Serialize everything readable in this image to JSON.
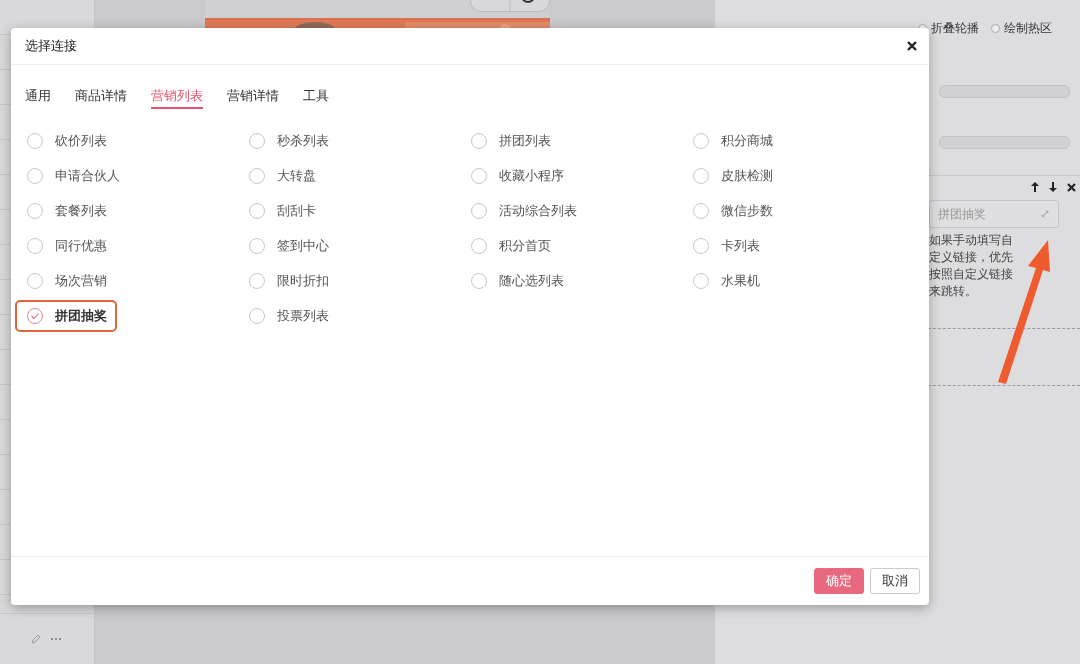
{
  "background": {
    "settings": {
      "display_options": [
        {
          "label": "折叠轮播",
          "selected": false
        },
        {
          "label": "绘制热区",
          "selected": false
        }
      ],
      "link_field": {
        "value": "拼团抽奖"
      },
      "hint": "如果手动填写自定义链接，优先按照自定义链接来跳转。"
    }
  },
  "dialog": {
    "title": "选择连接",
    "tabs": [
      {
        "label": "通用",
        "selected": false
      },
      {
        "label": "商品详情",
        "selected": false
      },
      {
        "label": "营销列表",
        "selected": true
      },
      {
        "label": "营销详情",
        "selected": false
      },
      {
        "label": "工具",
        "selected": false
      }
    ],
    "options": [
      {
        "label": "砍价列表",
        "selected": false
      },
      {
        "label": "秒杀列表",
        "selected": false
      },
      {
        "label": "拼团列表",
        "selected": false
      },
      {
        "label": "积分商城",
        "selected": false
      },
      {
        "label": "申请合伙人",
        "selected": false
      },
      {
        "label": "大转盘",
        "selected": false
      },
      {
        "label": "收藏小程序",
        "selected": false
      },
      {
        "label": "皮肤检测",
        "selected": false
      },
      {
        "label": "套餐列表",
        "selected": false
      },
      {
        "label": "刮刮卡",
        "selected": false
      },
      {
        "label": "活动综合列表",
        "selected": false
      },
      {
        "label": "微信步数",
        "selected": false
      },
      {
        "label": "同行优惠",
        "selected": false
      },
      {
        "label": "签到中心",
        "selected": false
      },
      {
        "label": "积分首页",
        "selected": false
      },
      {
        "label": "卡列表",
        "selected": false
      },
      {
        "label": "场次营销",
        "selected": false
      },
      {
        "label": "限时折扣",
        "selected": false
      },
      {
        "label": "随心选列表",
        "selected": false
      },
      {
        "label": "水果机",
        "selected": false
      },
      {
        "label": "拼团抽奖",
        "selected": true
      },
      {
        "label": "投票列表",
        "selected": false
      }
    ],
    "buttons": [
      {
        "label": "确定",
        "kind": "primary"
      },
      {
        "label": "取消",
        "kind": "default"
      }
    ]
  }
}
